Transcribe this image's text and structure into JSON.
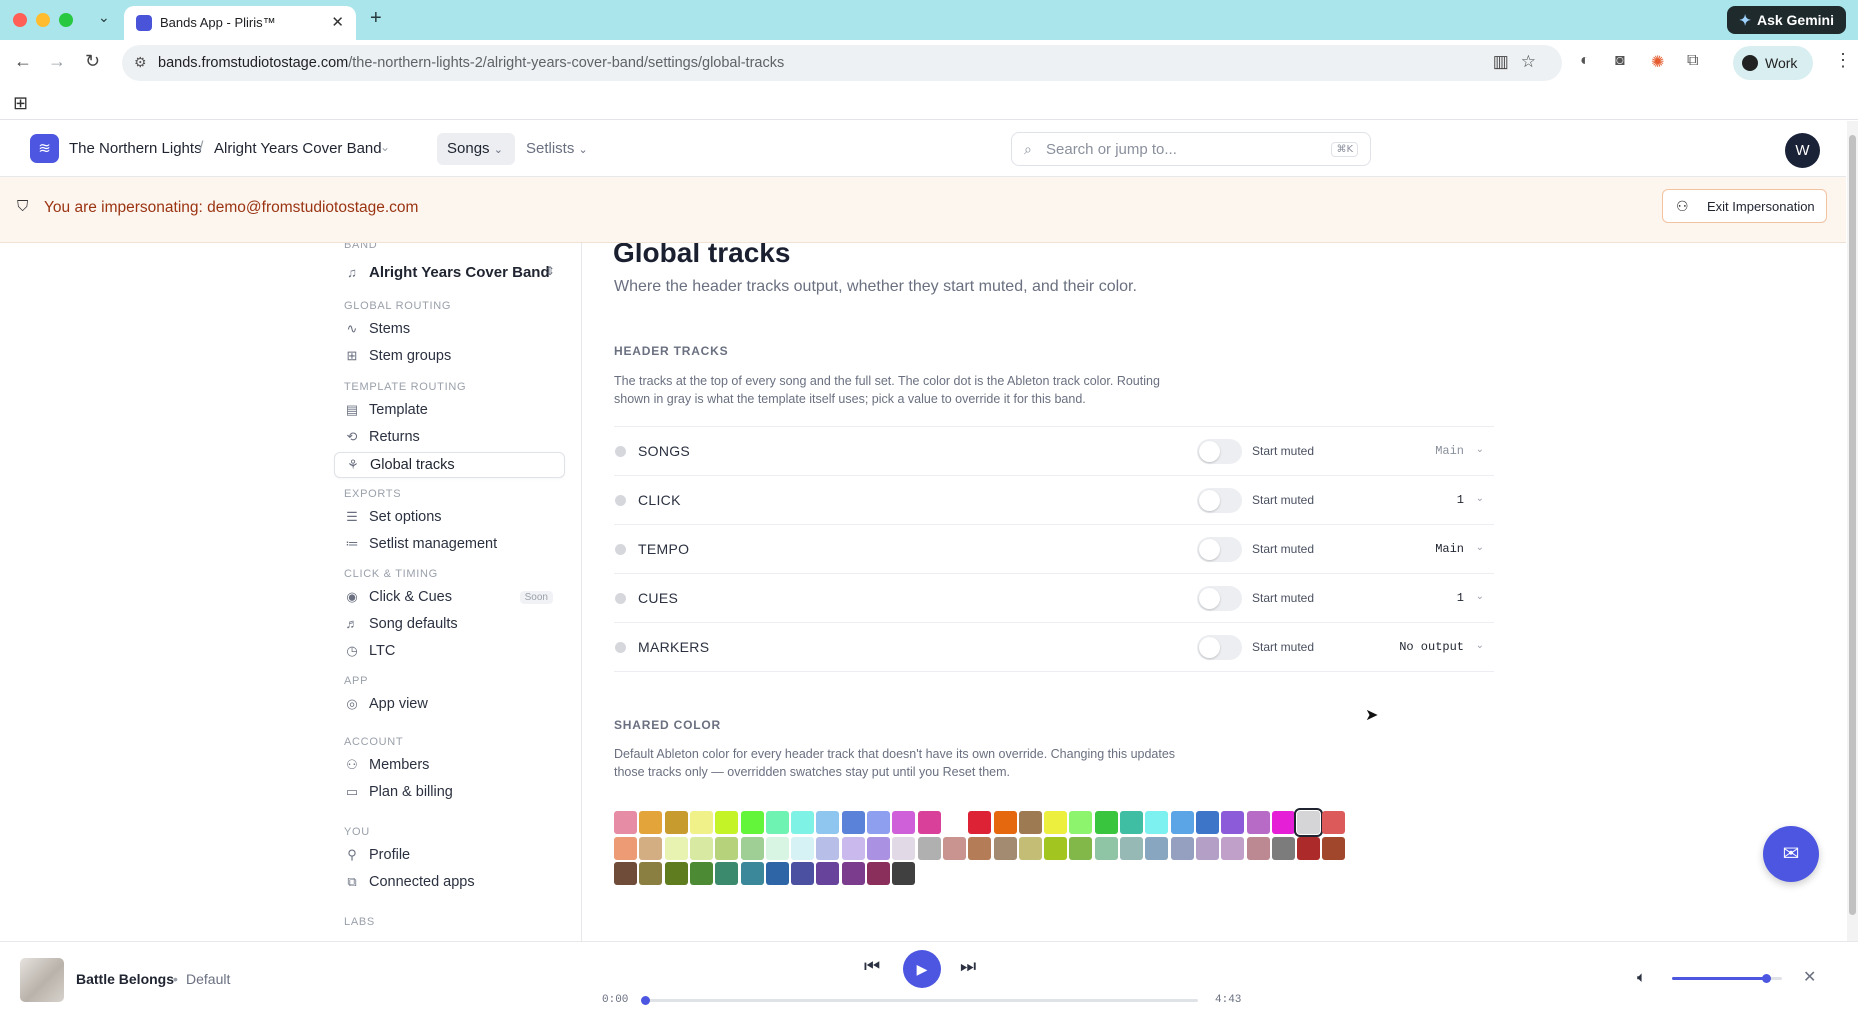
{
  "browser": {
    "tab_title": "Bands App - Pliris™",
    "ask_gemini": "Ask Gemini",
    "url_domain": "bands.fromstudiotostage.com",
    "url_path": "/the-northern-lights-2/alright-years-cover-band/settings/global-tracks",
    "profile": "Work"
  },
  "header": {
    "org": "The Northern Lights",
    "band": "Alright Years Cover Band",
    "nav": {
      "songs": "Songs",
      "setlists": "Setlists"
    },
    "search_placeholder": "Search or jump to...",
    "search_kbd": "⌘K",
    "avatar_initial": "W"
  },
  "banner": {
    "text": "You are impersonating: demo@fromstudiotostage.com",
    "exit_label": "Exit Impersonation"
  },
  "sidebar": {
    "band_head": "BAND",
    "band_name": "Alright Years Cover Band",
    "sections": [
      {
        "title": "GLOBAL ROUTING",
        "items": [
          {
            "label": "Stems",
            "icon": "waveform-icon"
          },
          {
            "label": "Stem groups",
            "icon": "grid-plus-icon"
          }
        ]
      },
      {
        "title": "TEMPLATE ROUTING",
        "items": [
          {
            "label": "Template",
            "icon": "layout-icon"
          },
          {
            "label": "Returns",
            "icon": "return-icon"
          },
          {
            "label": "Global tracks",
            "icon": "tracks-icon",
            "active": true
          }
        ]
      },
      {
        "title": "EXPORTS",
        "items": [
          {
            "label": "Set options",
            "icon": "sliders-icon"
          },
          {
            "label": "Setlist management",
            "icon": "list-icon"
          }
        ]
      },
      {
        "title": "CLICK & TIMING",
        "items": [
          {
            "label": "Click & Cues",
            "icon": "broadcast-icon",
            "badge": "Soon"
          },
          {
            "label": "Song defaults",
            "icon": "music-icon"
          },
          {
            "label": "LTC",
            "icon": "timer-icon"
          }
        ]
      },
      {
        "title": "APP",
        "items": [
          {
            "label": "App view",
            "icon": "eye-icon"
          }
        ]
      },
      {
        "title": "ACCOUNT",
        "items": [
          {
            "label": "Members",
            "icon": "users-icon"
          },
          {
            "label": "Plan & billing",
            "icon": "card-icon"
          }
        ]
      },
      {
        "title": "YOU",
        "items": [
          {
            "label": "Profile",
            "icon": "user-icon"
          },
          {
            "label": "Connected apps",
            "icon": "apps-icon"
          }
        ]
      },
      {
        "title": "LABS",
        "items": []
      }
    ]
  },
  "main": {
    "title": "Global tracks",
    "subtitle": "Where the header tracks output, whether they start muted, and their color.",
    "header_tracks": {
      "heading": "HEADER TRACKS",
      "description": "The tracks at the top of every song and the full set. The color dot is the Ableton track color. Routing shown in gray is what the template itself uses; pick a value to override it for this band.",
      "tracks": [
        {
          "name": "SONGS",
          "muted_label": "Start muted",
          "output": "Main",
          "override": false
        },
        {
          "name": "CLICK",
          "muted_label": "Start muted",
          "output": "1",
          "override": true
        },
        {
          "name": "TEMPO",
          "muted_label": "Start muted",
          "output": "Main",
          "override": true
        },
        {
          "name": "CUES",
          "muted_label": "Start muted",
          "output": "1",
          "override": true
        },
        {
          "name": "MARKERS",
          "muted_label": "Start muted",
          "output": "No output",
          "override": true
        }
      ]
    },
    "shared_color": {
      "heading": "SHARED COLOR",
      "description": "Default Ableton color for every header track that doesn't have its own override. Changing this updates those tracks only — overridden swatches stay put until you Reset them.",
      "selected": "#d5d5d8",
      "rows": [
        [
          "#e68ca5",
          "#e3a43a",
          "#c79b2e",
          "#f1f18a",
          "#c4f428",
          "#62f53a",
          "#6ef3b3",
          "#7ef2e5",
          "#8ec6f0",
          "#5b82d9",
          "#8e9ff0",
          "#d060d9",
          "#d9409a",
          "#ffffff",
          "#dd2236",
          "#e5680f",
          "#9d7a52",
          "#ecef3e",
          "#8cf56d",
          "#39c53d",
          "#3fbea3",
          "#7df0f0",
          "#5ba4e6",
          "#3d75c9",
          "#8b5bd9",
          "#b76ac6",
          "#e51fd6",
          "#d5d5d8",
          "#dd5a5a"
        ],
        [
          "#ec9b74",
          "#d3ae82",
          "#e8f2b1",
          "#d8e9a1",
          "#b6d27b",
          "#9fcf94",
          "#d8f4e2",
          "#d6f2f5",
          "#b7bfe8",
          "#cab9ed",
          "#ab91e1",
          "#e2d9e6",
          "#b0b0b0",
          "#c99390",
          "#b57d57",
          "#a38b72",
          "#c3bd75",
          "#a3c51f",
          "#82b749",
          "#8fc5a4",
          "#97b9b6",
          "#88a6bf",
          "#95a0c0",
          "#b4a0c7",
          "#c0a0c8",
          "#bc8892",
          "#7c7c7c",
          "#ad2a2a",
          "#a1472c"
        ],
        [
          "#6f4b3a",
          "#8a7e40",
          "#5f7d1f",
          "#4c8a33",
          "#3b8a6e",
          "#3a8899",
          "#2d65a6",
          "#4b51a0",
          "#67439c",
          "#7b3c8d",
          "#8a2f5c",
          "#404040"
        ]
      ]
    }
  },
  "player": {
    "song": "Battle Belongs",
    "separator": "•",
    "preset": "Default",
    "current_time": "0:00",
    "total_time": "4:43",
    "progress": 0.0,
    "volume": 0.85
  }
}
